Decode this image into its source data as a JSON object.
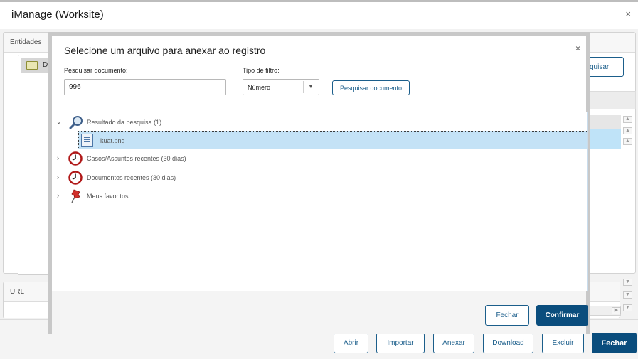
{
  "window": {
    "title": "iManage (Worksite)",
    "close_glyph": "×"
  },
  "background": {
    "entities_panel": {
      "header": "Entidades",
      "tree_item_label": "D",
      "tree_item_icon": "folder-icon"
    },
    "search_button_label": "quisar",
    "url_panel": {
      "header": "URL"
    }
  },
  "footer": {
    "buttons": [
      "Abrir",
      "Importar",
      "Anexar",
      "Download",
      "Excluir",
      "Fechar"
    ]
  },
  "modal": {
    "title": "Selecione um arquivo para anexar ao registro",
    "close_glyph": "×",
    "search_label": "Pesquisar documento:",
    "search_value": "996",
    "filter_label": "Tipo de filtro:",
    "filter_value": "Número",
    "search_button": "Pesquisar documento",
    "tree": [
      {
        "label": "Resultado da pesquisa (1)",
        "icon": "magnifier-icon",
        "expanded": true,
        "children": [
          {
            "label": "kuat.png",
            "icon": "document-icon",
            "selected": true
          }
        ]
      },
      {
        "label": "Casos/Assuntos recentes (30 dias)",
        "icon": "clock-icon",
        "expanded": false
      },
      {
        "label": "Documentos recentes (30 dias)",
        "icon": "clock-icon",
        "expanded": false
      },
      {
        "label": "Meus favoritos",
        "icon": "pushpin-icon",
        "expanded": false
      }
    ],
    "buttons": {
      "cancel": "Fechar",
      "confirm": "Confirmar"
    }
  },
  "colors": {
    "primary": "#0a4d7d",
    "link_blue": "#1b5e8b",
    "selection": "#c4e2f6",
    "clock_red": "#b01818"
  }
}
